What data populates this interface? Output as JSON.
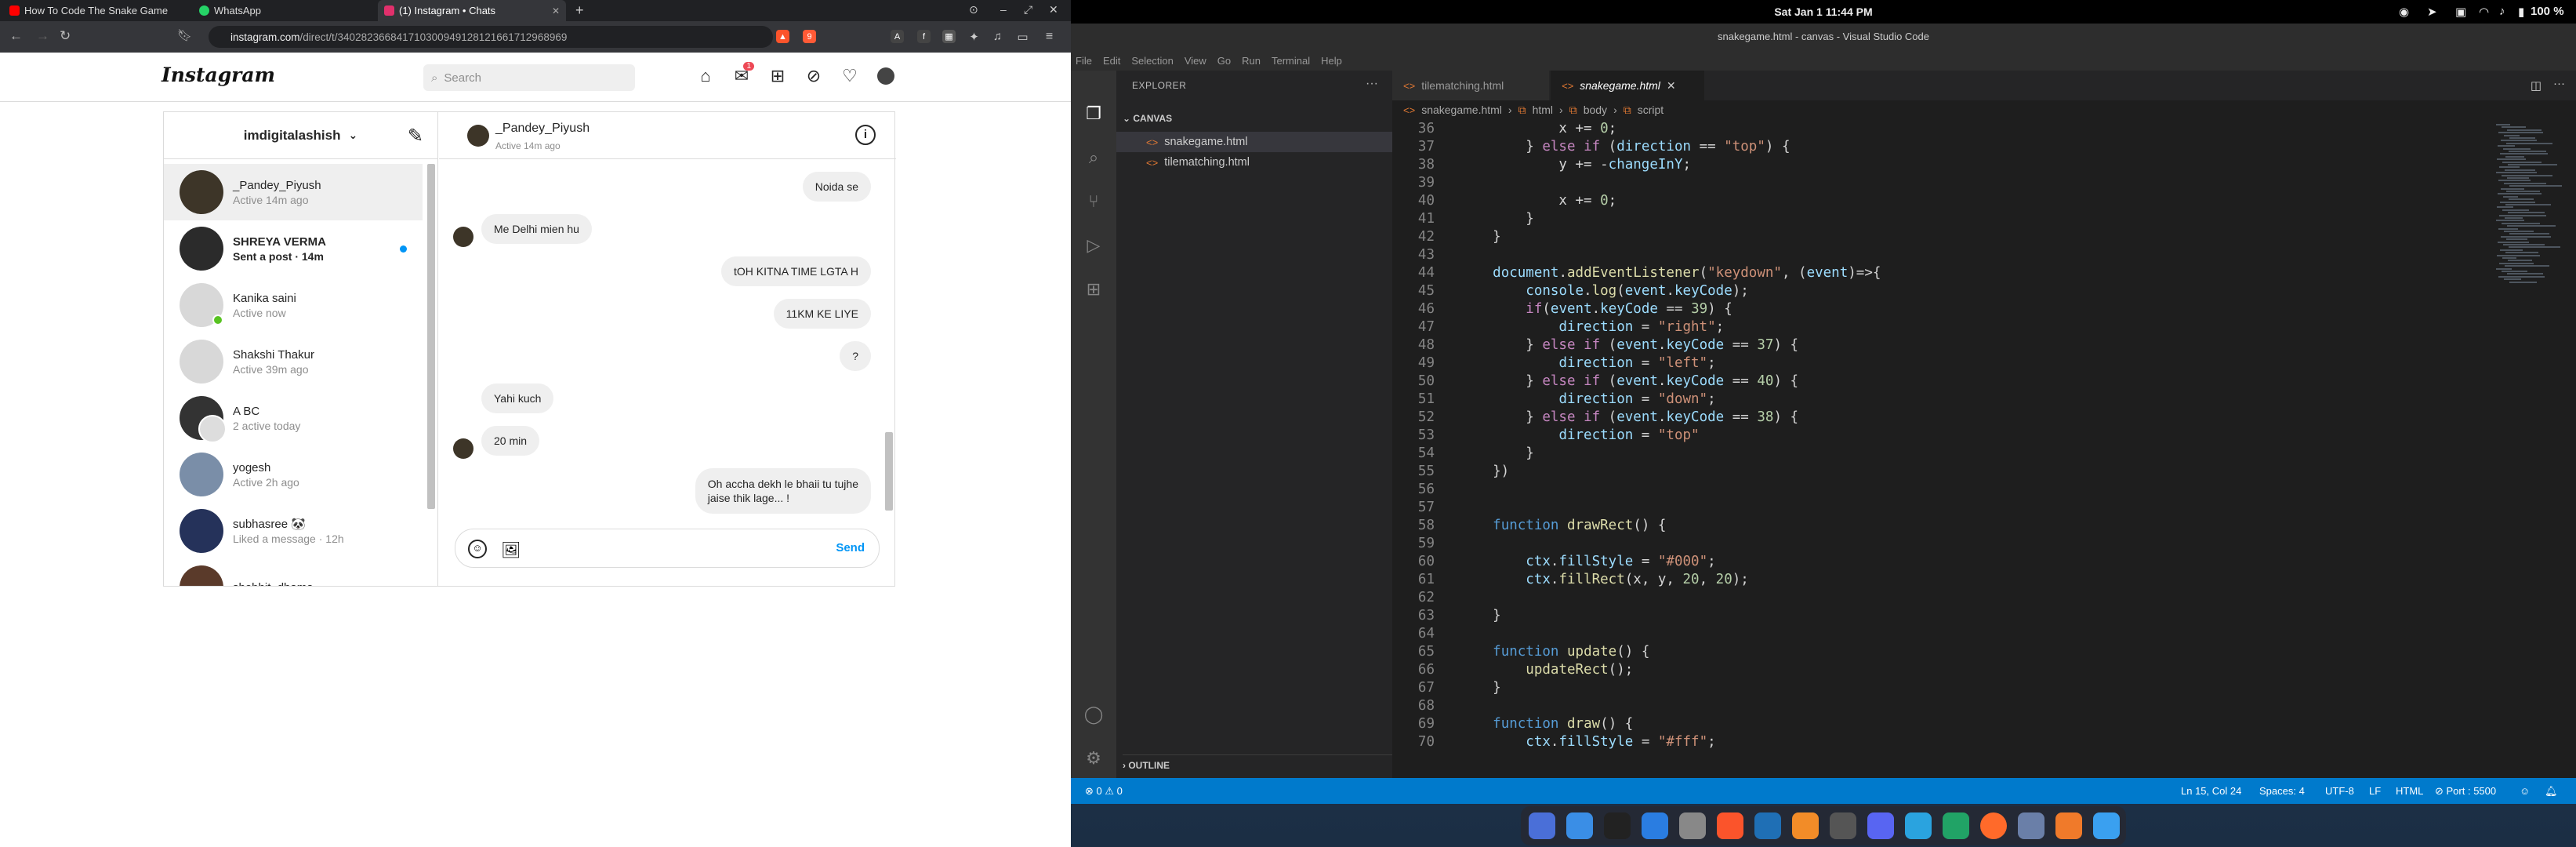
{
  "browser": {
    "tabs": [
      {
        "label": "How To Code The Snake Game",
        "color": "#ff0000"
      },
      {
        "label": "WhatsApp",
        "color": "#25d366"
      },
      {
        "label": "(1) Instagram • Chats",
        "color": "#e1306c"
      }
    ],
    "url_domain": "instagram.com",
    "url_path": "/direct/t/340282366841710300949128121661712968969",
    "ext_badge": "9"
  },
  "instagram": {
    "logo": "Instagram",
    "search_placeholder": "Search",
    "nav_badge": "1",
    "inbox_user": "imdigitalashish",
    "conversations": [
      {
        "name": "_Pandey_Piyush",
        "sub": "Active 14m ago",
        "color": "#3d3528"
      },
      {
        "name": "SHREYA VERMA",
        "sub": "Sent a post · 14m",
        "color": "#2b2b2b"
      },
      {
        "name": "Kanika saini",
        "sub": "Active now",
        "color": "#d0d0d0"
      },
      {
        "name": "Shakshi Thakur",
        "sub": "Active 39m ago",
        "color": "#d0d0d0"
      },
      {
        "name": "A BC",
        "sub": "2 active today",
        "color": "#333"
      },
      {
        "name": "yogesh",
        "sub": "Active 2h ago",
        "color": "#7a8ea8"
      },
      {
        "name": "subhasree 🐼",
        "sub": "Liked a message · 12h",
        "color": "#25325a"
      },
      {
        "name": "shobhit_dhama",
        "sub": "",
        "color": "#5a3a2a"
      }
    ],
    "chat": {
      "name": "_Pandey_Piyush",
      "status": "Active 14m ago",
      "messages": [
        {
          "text": "Noida se",
          "mine": true
        },
        {
          "text": "Me Delhi mien hu",
          "mine": false
        },
        {
          "text": "tOH KITNA TIME LGTA H",
          "mine": true
        },
        {
          "text": "11KM KE LIYE",
          "mine": true
        },
        {
          "text": "?",
          "mine": true
        },
        {
          "text": "Yahi kuch",
          "mine": false
        },
        {
          "text": "20 min",
          "mine": false
        },
        {
          "text": "Oh accha dekh le bhaii tu tujhe\njaise thik lage... !",
          "mine": true
        }
      ],
      "send_label": "Send"
    }
  },
  "desktop": {
    "clock": "Sat Jan 1  11:44 PM",
    "battery": "100 %"
  },
  "vscode": {
    "title": "snakegame.html - canvas - Visual Studio Code",
    "menu": [
      "File",
      "Edit",
      "Selection",
      "View",
      "Go",
      "Run",
      "Terminal",
      "Help"
    ],
    "explorer_title": "EXPLORER",
    "folder": "CANVAS",
    "files": [
      "snakegame.html",
      "tilematching.html"
    ],
    "outline": "OUTLINE",
    "tabs": [
      "tilematching.html",
      "snakegame.html"
    ],
    "breadcrumbs": [
      "snakegame.html",
      "html",
      "body",
      "script"
    ],
    "status": {
      "problems": "⊗ 0 ⚠ 0",
      "position": "Ln 15, Col 24",
      "spaces": "Spaces: 4",
      "encoding": "UTF-8",
      "eol": "LF",
      "lang": "HTML",
      "port": "Port : 5500"
    },
    "code": [
      {
        "n": "36",
        "t": "            x += 0;"
      },
      {
        "n": "37",
        "t": "        } else if (direction == \"top\") {"
      },
      {
        "n": "38",
        "t": "            y += -changeInY;"
      },
      {
        "n": "39",
        "t": ""
      },
      {
        "n": "40",
        "t": "            x += 0;"
      },
      {
        "n": "41",
        "t": "        }"
      },
      {
        "n": "42",
        "t": "    }"
      },
      {
        "n": "43",
        "t": ""
      },
      {
        "n": "44",
        "t": "    document.addEventListener(\"keydown\", (event)=>{"
      },
      {
        "n": "45",
        "t": "        console.log(event.keyCode);"
      },
      {
        "n": "46",
        "t": "        if(event.keyCode == 39) {"
      },
      {
        "n": "47",
        "t": "            direction = \"right\";"
      },
      {
        "n": "48",
        "t": "        } else if (event.keyCode == 37) {"
      },
      {
        "n": "49",
        "t": "            direction = \"left\";"
      },
      {
        "n": "50",
        "t": "        } else if (event.keyCode == 40) {"
      },
      {
        "n": "51",
        "t": "            direction = \"down\";"
      },
      {
        "n": "52",
        "t": "        } else if (event.keyCode == 38) {"
      },
      {
        "n": "53",
        "t": "            direction = \"top\""
      },
      {
        "n": "54",
        "t": "        }"
      },
      {
        "n": "55",
        "t": "    })"
      },
      {
        "n": "56",
        "t": ""
      },
      {
        "n": "57",
        "t": ""
      },
      {
        "n": "58",
        "t": "    function drawRect() {"
      },
      {
        "n": "59",
        "t": ""
      },
      {
        "n": "60",
        "t": "        ctx.fillStyle = \"#000\";"
      },
      {
        "n": "61",
        "t": "        ctx.fillRect(x, y, 20, 20);"
      },
      {
        "n": "62",
        "t": ""
      },
      {
        "n": "63",
        "t": "    }"
      },
      {
        "n": "64",
        "t": ""
      },
      {
        "n": "65",
        "t": "    function update() {"
      },
      {
        "n": "66",
        "t": "        updateRect();"
      },
      {
        "n": "67",
        "t": "    }"
      },
      {
        "n": "68",
        "t": ""
      },
      {
        "n": "69",
        "t": "    function draw() {"
      },
      {
        "n": "70",
        "t": "        ctx.fillStyle = \"#fff\";"
      }
    ]
  }
}
